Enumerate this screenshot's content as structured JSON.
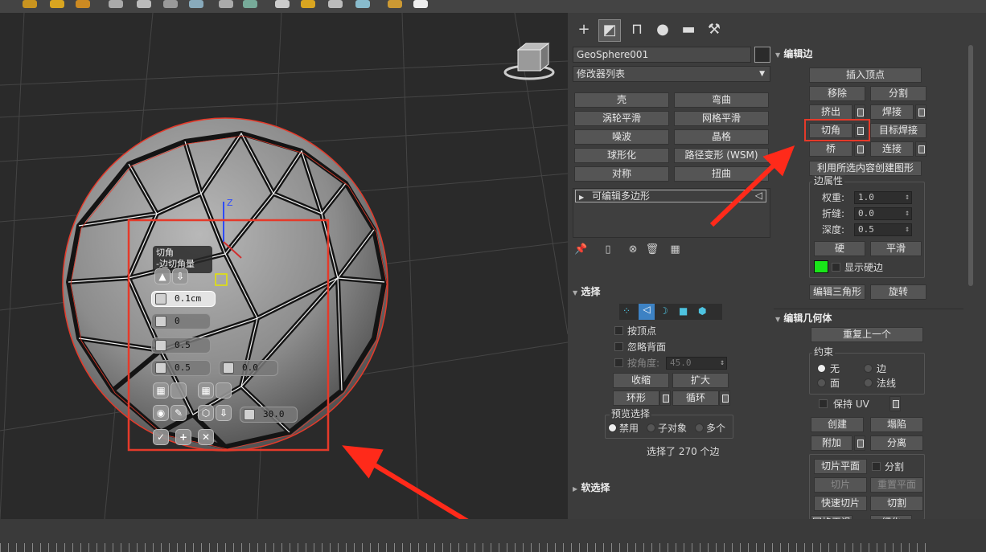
{
  "caddy": {
    "title": "切角",
    "subtitle": "-边切角量",
    "chamfer_amount": "0.1cm",
    "segments": "0",
    "tension": "0.5",
    "inset": "0.5",
    "depth": "0.0",
    "smooth_threshold": "30.0"
  },
  "panel": {
    "object_name": "GeoSphere001",
    "modifier_list": "修改器列表",
    "modifier_buttons": [
      "壳",
      "弯曲",
      "涡轮平滑",
      "网格平滑",
      "噪波",
      "晶格",
      "球形化",
      "路径变形 (WSM)",
      "对称",
      "扭曲"
    ],
    "stack_item": "可编辑多边形",
    "selection": {
      "header": "选择",
      "by_vertex": "按顶点",
      "ignore_backfacing": "忽略背面",
      "by_angle": "按角度:",
      "by_angle_value": "45.0",
      "shrink": "收缩",
      "grow": "扩大",
      "ring": "环形",
      "loop": "循环",
      "preview_title": "预览选择",
      "preview_disabled": "禁用",
      "preview_subobject": "子对象",
      "preview_multi": "多个",
      "status": "选择了 270 个边"
    },
    "soft_selection": "软选择",
    "edit_edges": {
      "header": "编辑边",
      "insert_vertex": "插入顶点",
      "remove": "移除",
      "split": "分割",
      "extrude": "挤出",
      "weld": "焊接",
      "chamfer": "切角",
      "target_weld": "目标焊接",
      "bridge": "桥",
      "connect": "连接",
      "create_shape": "利用所选内容创建图形",
      "edge_props": "边属性",
      "weight_label": "权重:",
      "weight": "1.0",
      "crease_label": "折缝:",
      "crease": "0.0",
      "depth_label": "深度:",
      "depth": "0.5",
      "hard": "硬",
      "smooth": "平滑",
      "display_hard": "显示硬边",
      "edit_tri": "编辑三角形",
      "turn": "旋转"
    },
    "edit_geometry": {
      "header": "编辑几何体",
      "repeat_last": "重复上一个",
      "constraints": "约束",
      "none": "无",
      "edge": "边",
      "face": "面",
      "normal": "法线",
      "preserve_uv": "保持 UV",
      "create": "创建",
      "collapse": "塌陷",
      "attach": "附加",
      "detach": "分离",
      "slice_plane": "切片平面",
      "split": "分割",
      "slice": "切片",
      "reset_plane": "重置平面",
      "quickslice": "快速切片",
      "cut": "切割",
      "meshsmooth": "网格平滑",
      "tessellate": "细化"
    }
  },
  "colors": {
    "highlight": "#e53a2a",
    "hard_edge_swatch": "#19e619"
  }
}
